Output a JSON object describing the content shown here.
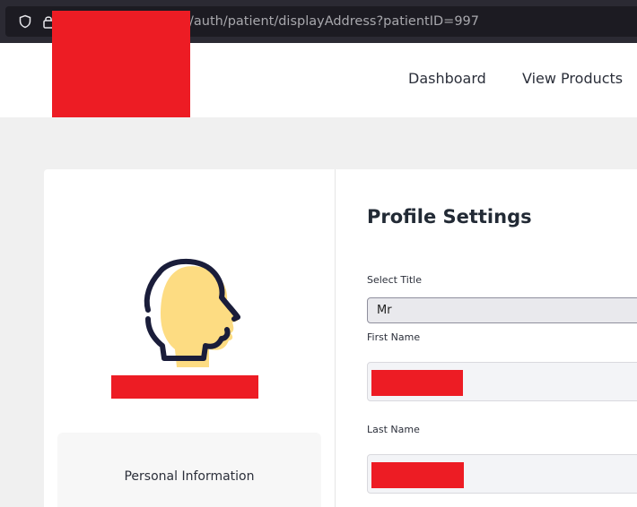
{
  "browser": {
    "url_visible": "/auth/patient/displayAddress?patientID=997"
  },
  "nav": {
    "dashboard": "Dashboard",
    "view_products": "View Products"
  },
  "profile": {
    "title": "Profile Settings",
    "personal_information": "Personal Information",
    "select_title_label": "Select Title",
    "select_title_value": "Mr",
    "first_name_label": "First Name",
    "last_name_label": "Last Name"
  },
  "icons": [
    "shield-icon",
    "lock-icon",
    "user-avatar-icon"
  ],
  "colors": {
    "redaction": "#ed1c24",
    "avatar_fill": "#fddc82",
    "avatar_stroke": "#1a1d3a",
    "browser_chrome": "#2b2a33"
  }
}
